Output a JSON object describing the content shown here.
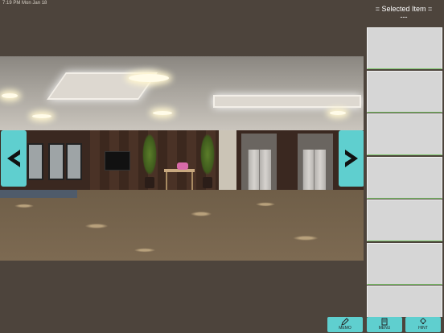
{
  "status_bar": {
    "time": "7:19 PM  Mon Jan 18"
  },
  "inventory": {
    "title": "= Selected Item =",
    "selected": "---",
    "slot_count": 7
  },
  "bottom_buttons": [
    {
      "label": "MEMO",
      "icon": "pencil-icon"
    },
    {
      "label": "MENU",
      "icon": "menu-icon"
    },
    {
      "label": "HINT",
      "icon": "lightbulb-icon"
    }
  ],
  "nav": {
    "left_icon": "arrow-left-icon",
    "right_icon": "arrow-right-icon"
  },
  "colors": {
    "panel_bg": "#4d443c",
    "accent": "#5fcfcf",
    "slot_bg": "#d6d6d6"
  }
}
